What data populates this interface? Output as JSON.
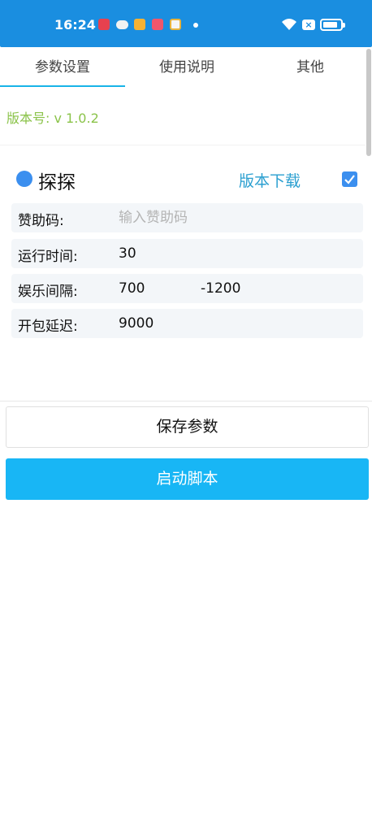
{
  "status_bar": {
    "time": "16:24",
    "notification_icons": [
      "video-app-icon",
      "wechat-icon",
      "message-app-icon",
      "shopping-app-icon",
      "app-icon"
    ],
    "battery_level": 0.85,
    "accent_color": "#1a8ee0"
  },
  "tabs": [
    {
      "label": "参数设置",
      "active": true
    },
    {
      "label": "使用说明",
      "active": false
    },
    {
      "label": "其他",
      "active": false
    }
  ],
  "version_label": "版本号: v 1.0.2",
  "section": {
    "title": "探探",
    "download_link": "版本下载",
    "enabled": true
  },
  "fields": {
    "sponsor_code": {
      "label": "赞助码:",
      "value": "",
      "placeholder": "输入赞助码"
    },
    "run_time": {
      "label": "运行时间:",
      "value": "30"
    },
    "interval": {
      "label": "娱乐间隔:",
      "min": "700",
      "max": "-1200"
    },
    "open_delay": {
      "label": "开包延迟:",
      "value": "9000"
    }
  },
  "buttons": {
    "save": "保存参数",
    "start": "启动脚本"
  },
  "colors": {
    "version_text": "#8bc34a",
    "link": "#2a9fd0",
    "primary_button": "#18b6f5",
    "tab_indicator": "#18b4e8"
  }
}
